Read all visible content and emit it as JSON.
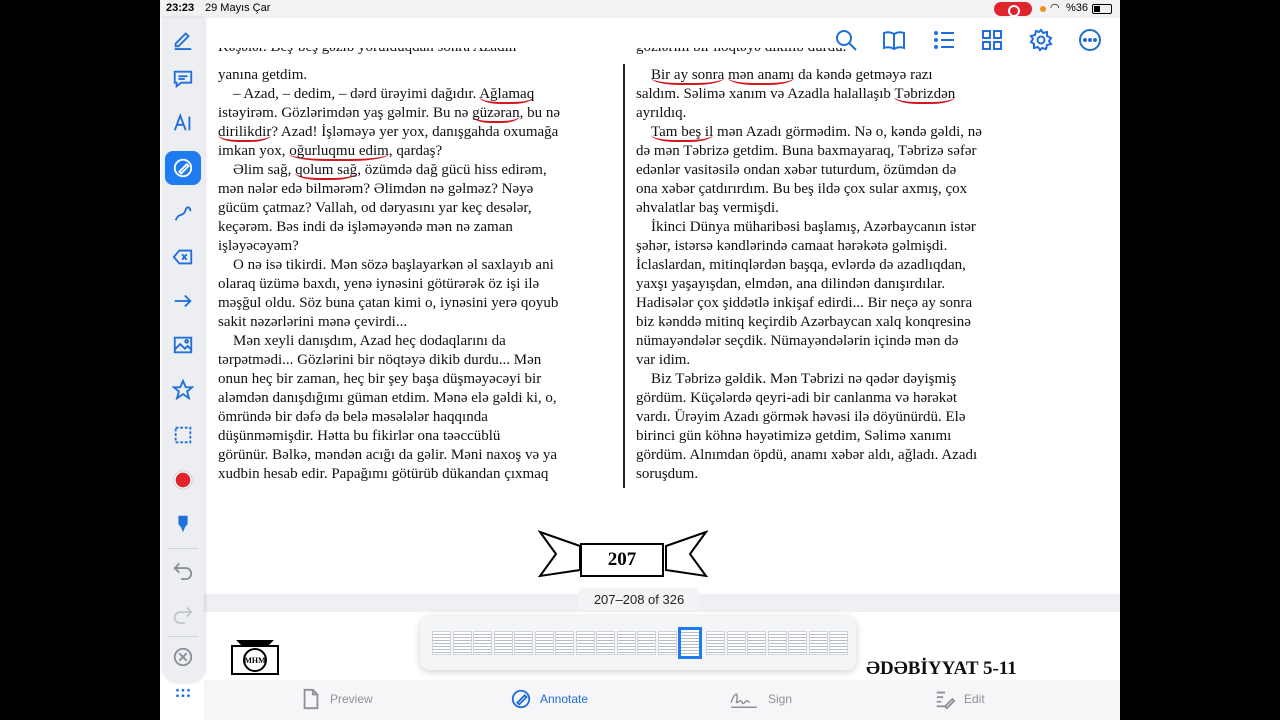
{
  "status": {
    "time": "23:23",
    "date": "29 Mayıs Çar",
    "battery": "%36"
  },
  "left_page": {
    "cut_line": "Kəşələr. Beş-beş gəzib yorulduqdan sonra Azadın",
    "paragraphs": [
      [
        "yanına getdim."
      ],
      [
        "    – Azad, – dedim, – dərd ürəyimi dağıdır. ",
        {
          "u": "Ağlamaq"
        }
      ],
      [
        "istəyirəm. Gözlərimdən yaş gəlmir. Bu nə ",
        {
          "u": "güzəran"
        },
        ", bu nə"
      ],
      [
        {
          "u": "dirilikdir"
        },
        "? Azad! İşləməyə yer yox, danışgahda oxumağa"
      ],
      [
        "imkan yox, ",
        {
          "u": "oğurluqmu edim"
        },
        ", qardaş?"
      ],
      [
        "    Əlim sağ, ",
        {
          "u": "qolum sağ"
        },
        ", özümdə dağ gücü hiss edirəm,"
      ],
      [
        "mən nələr edə bilmərəm? Əlimdən nə gəlməz? Nəyə"
      ],
      [
        "gücüm çatmaz? Vallah, od dəryasını yar keç desələr,"
      ],
      [
        "keçərəm. Bəs indi də işləməyəndə mən nə zaman"
      ],
      [
        "işləyəcəyəm?"
      ],
      [
        "    O nə isə tikirdi. Mən sözə başlayarkən əl saxlayıb ani"
      ],
      [
        "olaraq üzümə baxdı, yenə iynəsini götürərək öz işi ilə"
      ],
      [
        "məşğul oldu. Söz buna çatan kimi o, iynəsini yerə qoyub"
      ],
      [
        "sakit nəzərlərini mənə çevirdi..."
      ],
      [
        "    Mən xeyli danışdım, Azad heç dodaqlarını da"
      ],
      [
        "tərpətmədi... Gözlərini bir nöqtəyə dikib durdu... Mən"
      ],
      [
        "onun heç bir zaman, heç bir şey başa düşməyəcəyi bir"
      ],
      [
        "aləmdən danışdığımı güman etdim. Mənə elə gəldi ki, o,"
      ],
      [
        "ömründə bir dəfə də belə məsələlər haqqında"
      ],
      [
        "düşünməmişdir. Hətta bu fikirlər ona təəccüblü"
      ],
      [
        "görünür. Bəlkə, məndən acığı da gəlir. Məni naxoş və ya"
      ],
      [
        "xudbin hesab edir. Papağımı götürüb dükandan çıxmaq"
      ]
    ]
  },
  "right_page": {
    "cut_line": "gözlərim bir nöqtəyə dikilib durdu.",
    "paragraphs": [
      [
        "    ",
        {
          "u": "Bir ay sonra"
        },
        " ",
        {
          "u": "mən anamı"
        },
        " da kəndə getməyə razı"
      ],
      [
        "saldım. Səlimə xanım və Azadla halallaşıb ",
        {
          "u": "Təbrizdən"
        }
      ],
      [
        "ayrıldıq."
      ],
      [
        "    ",
        {
          "u": "Tam beş il"
        },
        " mən Azadı görmədim. Nə o, kəndə gəldi, nə"
      ],
      [
        "də mən Təbrizə getdim. Buna baxmayaraq, Təbrizə səfər"
      ],
      [
        "edənlər vasitəsilə ondan xəbər tuturdum, özümdən də"
      ],
      [
        "ona xəbər çatdırırdım. Bu beş ildə çox sular axmış, çox"
      ],
      [
        "əhvalatlar baş vermişdi."
      ],
      [
        "    İkinci Dünya müharibəsi başlamış, Azərbaycanın istər"
      ],
      [
        "şəhər, istərsə kəndlərində camaat hərəkətə gəlmişdi."
      ],
      [
        "İclaslardan, mitinqlərdən başqa, evlərdə də azadlıqdan,"
      ],
      [
        "yaxşı yaşayışdan, elmdən, ana dilindən danışırdılar."
      ],
      [
        "Hadisələr çox şiddətlə inkişaf edirdi... Bir neçə ay sonra"
      ],
      [
        "biz kənddə mitinq keçirdib Azərbaycan xalq konqresinə"
      ],
      [
        "nümayəndələr seçdik. Nümayəndələrin içində mən də"
      ],
      [
        "var idim."
      ],
      [
        "    Biz Təbrizə gəldik. Mən Təbrizi nə qədər dəyişmiş"
      ],
      [
        "gördüm. Küçələrdə qeyri-adi bir canlanma və hərəkət"
      ],
      [
        "vardı. Ürəyim Azadı görmək həvəsi ilə döyünürdü. Elə"
      ],
      [
        "birinci gün köhnə həyətimizə getdim, Səlimə xanımı"
      ],
      [
        "gördüm. Alnımdan öpdü, anamı xəbər aldı, ağladı. Azadı"
      ],
      [
        "soruşdum."
      ]
    ]
  },
  "page_number": "207",
  "page_count": "207–208 of 326",
  "footer_title": "ƏDƏBİYYAT 5-11",
  "logo_text": "MHM",
  "modes": {
    "preview": "Preview",
    "annotate": "Annotate",
    "sign": "Sign",
    "edit": "Edit"
  },
  "icons": {
    "top": [
      "search-icon",
      "book-icon",
      "list-icon",
      "grid-icon",
      "gear-icon",
      "more-icon"
    ],
    "left": [
      "pencil-icon",
      "comment-icon",
      "text-icon",
      "highlighter-icon",
      "pen-icon",
      "eraser-icon",
      "arrow-icon",
      "image-icon",
      "star-icon",
      "selection-icon",
      "color-icon",
      "marker-icon",
      "undo-icon",
      "redo-icon",
      "close-icon",
      "more-icon"
    ]
  },
  "thumbnail_count": 20,
  "selected_thumbnail": 12,
  "colors": {
    "accent": "#1f7cf0",
    "ink": "#d4171f",
    "record": "#e0232d"
  }
}
